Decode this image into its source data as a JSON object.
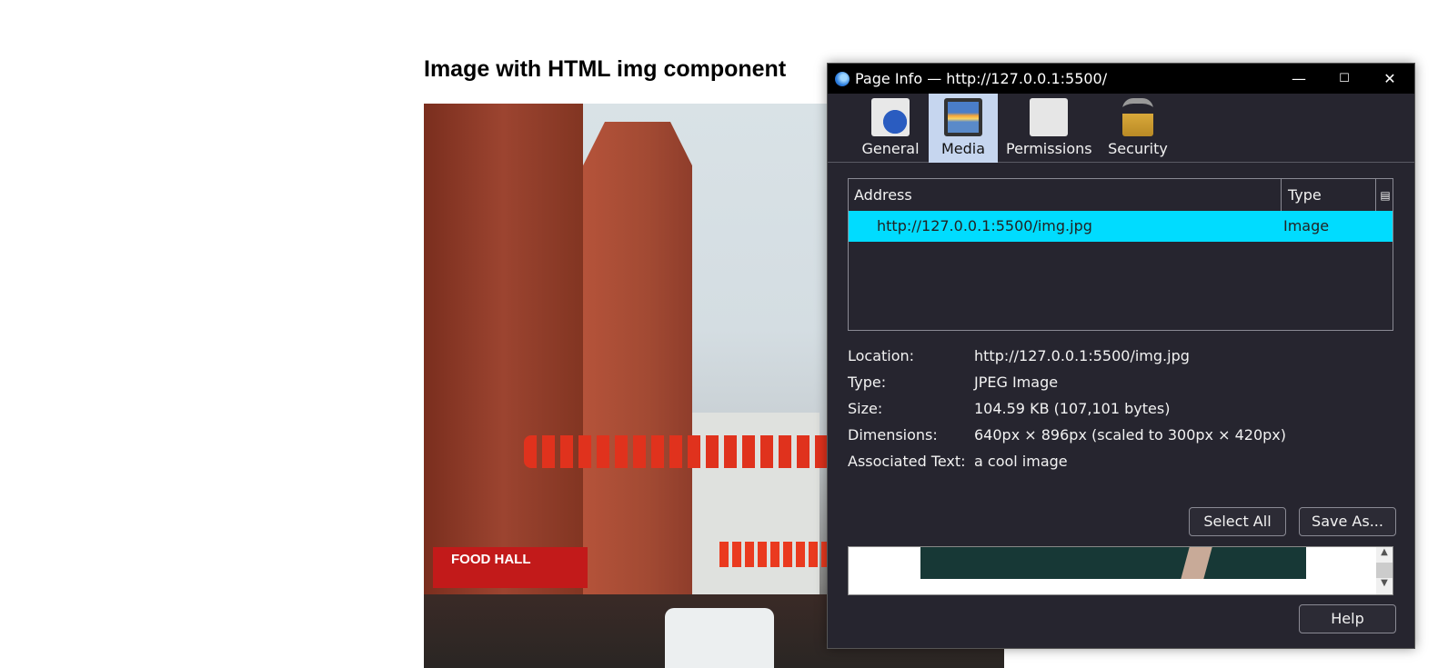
{
  "page": {
    "heading": "Image with HTML img component",
    "photo_sign": "FOOD HALL"
  },
  "dialog": {
    "title": "Page Info — http://127.0.0.1:5500/",
    "controls": {
      "minimize": "—",
      "maximize": "☐",
      "close": "✕"
    },
    "tabs": [
      {
        "label": "General",
        "icon": "info-document-icon"
      },
      {
        "label": "Media",
        "icon": "media-icon",
        "active": true
      },
      {
        "label": "Permissions",
        "icon": "permissions-icon"
      },
      {
        "label": "Security",
        "icon": "padlock-icon"
      }
    ],
    "table": {
      "columns": [
        "Address",
        "Type"
      ],
      "rows": [
        {
          "address": "http://127.0.0.1:5500/img.jpg",
          "type": "Image",
          "selected": true
        }
      ]
    },
    "info": [
      {
        "label": "Location:",
        "value": "http://127.0.0.1:5500/img.jpg"
      },
      {
        "label": "Type:",
        "value": "JPEG Image"
      },
      {
        "label": "Size:",
        "value": "104.59 KB (107,101 bytes)"
      },
      {
        "label": "Dimensions:",
        "value": "640px × 896px (scaled to 300px × 420px)"
      },
      {
        "label": "Associated Text:",
        "value": "a cool image"
      }
    ],
    "buttons": {
      "select_all": "Select All",
      "save_as": "Save As...",
      "help": "Help"
    },
    "colors": {
      "selected_row": "#00dcff",
      "background": "#26252f",
      "active_tab": "#c6d6ef"
    }
  }
}
